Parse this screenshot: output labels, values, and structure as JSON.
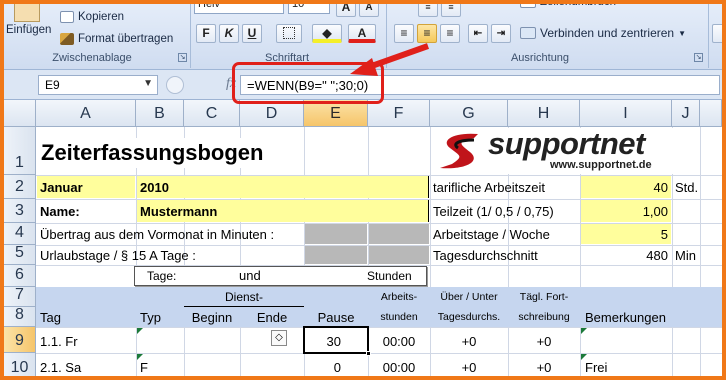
{
  "ribbon": {
    "clipboard": {
      "paste_label": "Einfügen",
      "copy_label": "Kopieren",
      "format_painter_label": "Format übertragen",
      "group_label": "Zwischenablage"
    },
    "font": {
      "font_name": "Helv",
      "font_size": "10",
      "grow_label": "A",
      "shrink_label": "A",
      "bold_label": "F",
      "italic_label": "K",
      "underline_label": "U",
      "font_color_label": "A",
      "group_label": "Schriftart"
    },
    "alignment": {
      "wrap_text_label": "Zeilenumbruch",
      "merge_center_label": "Verbinden und zentrieren",
      "group_label": "Ausrichtung"
    },
    "accent_color": "#e0201a"
  },
  "formula_bar": {
    "name_box": "E9",
    "fx_label": "fx",
    "formula": "=WENN(B9=\" \";30;0)"
  },
  "columns": [
    "A",
    "B",
    "C",
    "D",
    "E",
    "F",
    "G",
    "H",
    "I",
    "J"
  ],
  "rows": [
    "1",
    "2",
    "3",
    "4",
    "5",
    "6",
    "7",
    "8",
    "9",
    "10"
  ],
  "sheet": {
    "title": "Zeiterfassungsbogen",
    "logo": {
      "text": "supportnet",
      "url": "www.supportnet.de"
    },
    "month_label": "Januar",
    "year_value": "2010",
    "name_label": "Name:",
    "name_value": "Mustermann",
    "carryover_label": "Übertrag aus dem Vormonat in Minuten :",
    "vacation_label": "Urlaubstage / § 15 A Tage :",
    "days_box": {
      "days_label": "Tage:",
      "and_label": "und",
      "hours_label": "Stunden"
    },
    "contract_hours_label": "tarifliche Arbeitszeit",
    "contract_hours_value": "40",
    "contract_hours_unit": "Std.",
    "part_time_label": "Teilzeit (1/  0,5 / 0,75)",
    "part_time_value": "1,00",
    "workdays_label": "Arbeitstage / Woche",
    "workdays_value": "5",
    "daily_avg_label": "Tagesdurchschnitt",
    "daily_avg_value": "480",
    "daily_avg_unit": "Min",
    "table_headers": {
      "day": "Tag",
      "type": "Typ",
      "duty": "Dienst-",
      "start": "Beginn",
      "end": "Ende",
      "break": "Pause",
      "work_hours": "Arbeits-",
      "work_hours2": "stunden",
      "over_under": "Über / Unter",
      "over_under2": "Tagesdurchs.",
      "daily_cont": "Tägl. Fort-",
      "daily_cont2": "schreibung",
      "remarks": "Bemerkungen"
    },
    "rows": [
      {
        "day": "1.1. Fr",
        "type": "",
        "start": "",
        "end": "",
        "break": "30",
        "work_hours": "00:00",
        "over_under": "+0",
        "daily_cont": "+0",
        "remarks": ""
      },
      {
        "day": "2.1. Sa",
        "type": "F",
        "start": "",
        "end": "",
        "break": "0",
        "work_hours": "00:00",
        "over_under": "+0",
        "daily_cont": "+0",
        "remarks": "Frei"
      }
    ]
  }
}
